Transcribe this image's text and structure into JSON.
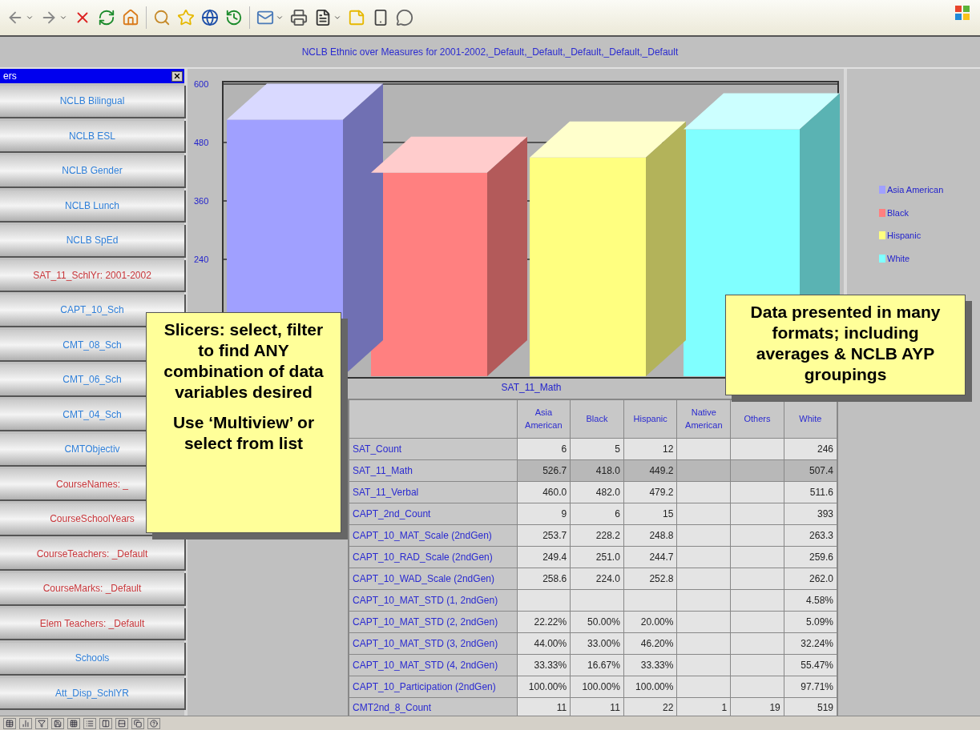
{
  "report_title": "NCLB Ethnic over Measures for 2001-2002,_Default,_Default,_Default,_Default,_Default",
  "slicers": {
    "title": "ers",
    "items": [
      {
        "label": "NCLB Bilingual",
        "color": "#2f7fd8"
      },
      {
        "label": "NCLB ESL",
        "color": "#2f7fd8"
      },
      {
        "label": "NCLB Gender",
        "color": "#2f7fd8"
      },
      {
        "label": "NCLB Lunch",
        "color": "#2f7fd8"
      },
      {
        "label": "NCLB SpEd",
        "color": "#2f7fd8"
      },
      {
        "label": "SAT_11_SchlYr: 2001-2002",
        "color": "#c8363a"
      },
      {
        "label": "CAPT_10_Sch",
        "color": "#2f7fd8"
      },
      {
        "label": "CMT_08_Sch",
        "color": "#2f7fd8"
      },
      {
        "label": "CMT_06_Sch",
        "color": "#2f7fd8"
      },
      {
        "label": "CMT_04_Sch",
        "color": "#2f7fd8"
      },
      {
        "label": "CMTObjectiv",
        "color": "#2f7fd8"
      },
      {
        "label": "CourseNames: _",
        "color": "#c8363a"
      },
      {
        "label": "CourseSchoolYears",
        "color": "#c8363a"
      },
      {
        "label": "CourseTeachers: _Default",
        "color": "#c8363a"
      },
      {
        "label": "CourseMarks: _Default",
        "color": "#c8363a"
      },
      {
        "label": "Elem Teachers: _Default",
        "color": "#c8363a"
      },
      {
        "label": "Schools",
        "color": "#2f7fd8"
      },
      {
        "label": "Att_Disp_SchlYR",
        "color": "#2f7fd8"
      }
    ]
  },
  "chart": {
    "chart_data": {
      "type": "bar",
      "categories": [
        "SAT_11_Math"
      ],
      "series": [
        {
          "name": "Asia American",
          "color": "#a0a0ff",
          "values": [
            527
          ]
        },
        {
          "name": "Black",
          "color": "#ff8080",
          "values": [
            418
          ]
        },
        {
          "name": "Hispanic",
          "color": "#ffff80",
          "values": [
            449
          ]
        },
        {
          "name": "White",
          "color": "#80ffff",
          "values": [
            507
          ]
        }
      ],
      "yticks": [
        240,
        360,
        480,
        600
      ],
      "ylim": [
        0,
        600
      ],
      "grid": true
    }
  },
  "table": {
    "columns": [
      "Asia American",
      "Black",
      "Hispanic",
      "Native American",
      "Others",
      "White"
    ],
    "rows": [
      {
        "name": "SAT_Count",
        "selected": false,
        "cells": [
          "6",
          "5",
          "12",
          "",
          "",
          "246"
        ]
      },
      {
        "name": "SAT_11_Math",
        "selected": true,
        "cells": [
          "526.7",
          "418.0",
          "449.2",
          "",
          "",
          "507.4"
        ]
      },
      {
        "name": "SAT_11_Verbal",
        "selected": false,
        "cells": [
          "460.0",
          "482.0",
          "479.2",
          "",
          "",
          "511.6"
        ]
      },
      {
        "name": "CAPT_2nd_Count",
        "selected": false,
        "cells": [
          "9",
          "6",
          "15",
          "",
          "",
          "393"
        ]
      },
      {
        "name": "CAPT_10_MAT_Scale (2ndGen)",
        "selected": false,
        "cells": [
          "253.7",
          "228.2",
          "248.8",
          "",
          "",
          "263.3"
        ]
      },
      {
        "name": "CAPT_10_RAD_Scale (2ndGen)",
        "selected": false,
        "cells": [
          "249.4",
          "251.0",
          "244.7",
          "",
          "",
          "259.6"
        ]
      },
      {
        "name": "CAPT_10_WAD_Scale (2ndGen)",
        "selected": false,
        "cells": [
          "258.6",
          "224.0",
          "252.8",
          "",
          "",
          "262.0"
        ]
      },
      {
        "name": "CAPT_10_MAT_STD (1, 2ndGen)",
        "selected": false,
        "cells": [
          "",
          "",
          "",
          "",
          "",
          "4.58%"
        ]
      },
      {
        "name": "CAPT_10_MAT_STD (2, 2ndGen)",
        "selected": false,
        "cells": [
          "22.22%",
          "50.00%",
          "20.00%",
          "",
          "",
          "5.09%"
        ]
      },
      {
        "name": "CAPT_10_MAT_STD (3, 2ndGen)",
        "selected": false,
        "cells": [
          "44.00%",
          "33.00%",
          "46.20%",
          "",
          "",
          "32.24%"
        ]
      },
      {
        "name": "CAPT_10_MAT_STD (4, 2ndGen)",
        "selected": false,
        "cells": [
          "33.33%",
          "16.67%",
          "33.33%",
          "",
          "",
          "55.47%"
        ]
      },
      {
        "name": "CAPT_10_Participation (2ndGen)",
        "selected": false,
        "cells": [
          "100.00%",
          "100.00%",
          "100.00%",
          "",
          "",
          "97.71%"
        ]
      },
      {
        "name": "CMT2nd_8_Count",
        "selected": false,
        "cells": [
          "11",
          "11",
          "22",
          "1",
          "19",
          "519"
        ]
      }
    ]
  },
  "callouts": [
    {
      "paragraphs": [
        "Slicers: select, filter to find ANY combination of data variables desired",
        "Use ‘Multiview’ or select from list"
      ]
    },
    {
      "paragraphs": [
        "Data presented in many formats; including averages & NCLB AYP groupings"
      ]
    }
  ]
}
